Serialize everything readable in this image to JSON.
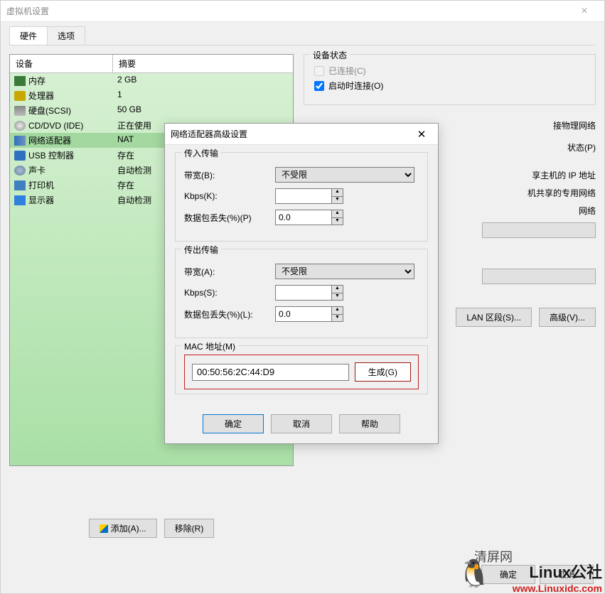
{
  "window": {
    "title": "虚拟机设置"
  },
  "tabs": {
    "hardware": "硬件",
    "options": "选项"
  },
  "devTable": {
    "head_device": "设备",
    "head_summary": "摘要",
    "rows": [
      {
        "name": "内存",
        "summary": "2 GB",
        "icon": "mem"
      },
      {
        "name": "处理器",
        "summary": "1",
        "icon": "cpu"
      },
      {
        "name": "硬盘(SCSI)",
        "summary": "50 GB",
        "icon": "disk"
      },
      {
        "name": "CD/DVD (IDE)",
        "summary": "正在使用",
        "icon": "cd"
      },
      {
        "name": "网络适配器",
        "summary": "NAT",
        "icon": "net",
        "selected": true
      },
      {
        "name": "USB 控制器",
        "summary": "存在",
        "icon": "usb"
      },
      {
        "name": "声卡",
        "summary": "自动检测",
        "icon": "snd"
      },
      {
        "name": "打印机",
        "summary": "存在",
        "icon": "prn"
      },
      {
        "name": "显示器",
        "summary": "自动检测",
        "icon": "disp"
      }
    ]
  },
  "addRemove": {
    "add": "添加(A)...",
    "remove": "移除(R)"
  },
  "right": {
    "status_legend": "设备状态",
    "connected": "已连接(C)",
    "connect_on_start": "启动时连接(O)",
    "partial1": "接物理网络",
    "partial2": "状态(P)",
    "partial3": "享主机的 IP 地址",
    "partial4": "机共享的专用网络",
    "partial5": "网络",
    "lan_segments": "LAN 区段(S)...",
    "advanced": "高级(V)..."
  },
  "bottom": {
    "ok": "确定",
    "cancel": "取消"
  },
  "dlg": {
    "title": "网络适配器高级设置",
    "incoming_legend": "传入传输",
    "outgoing_legend": "传出传输",
    "bandwidth_b": "带宽(B):",
    "bandwidth_a": "带宽(A):",
    "kbps_k": "Kbps(K):",
    "kbps_s": "Kbps(S):",
    "packet_loss_p": "数据包丢失(%)(P)",
    "packet_loss_l": "数据包丢失(%)(L):",
    "unlimited": "不受限",
    "zero": "0.0",
    "mac_legend": "MAC 地址(M)",
    "mac_value": "00:50:56:2C:44:D9",
    "generate": "生成(G)",
    "ok": "确定",
    "cancel": "取消",
    "help": "帮助"
  },
  "watermark": {
    "cn": "清屏网",
    "brand": "Linux公社",
    "url": "www.Linuxidc.com"
  }
}
